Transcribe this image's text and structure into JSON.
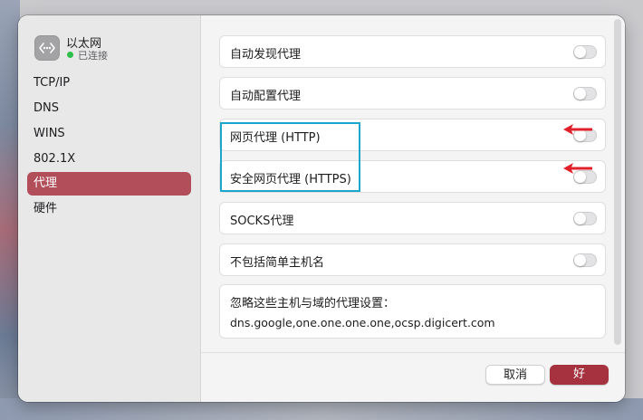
{
  "interface": {
    "name": "以太网",
    "status": "已连接",
    "icon": "ethernet-icon",
    "status_color": "#2fbe4a"
  },
  "sidebar": {
    "items": [
      {
        "label": "TCP/IP"
      },
      {
        "label": "DNS"
      },
      {
        "label": "WINS"
      },
      {
        "label": "802.1X"
      },
      {
        "label": "代理",
        "active": true
      },
      {
        "label": "硬件"
      }
    ],
    "active_color": "#b24e5a"
  },
  "proxies": [
    {
      "label": "自动发现代理",
      "enabled": false
    },
    {
      "label": "自动配置代理",
      "enabled": false
    },
    {
      "label": "网页代理 (HTTP)",
      "enabled": false
    },
    {
      "label": "安全网页代理 (HTTPS)",
      "enabled": false
    },
    {
      "label": "SOCKS代理",
      "enabled": false
    },
    {
      "label": "不包括简单主机名",
      "enabled": false
    }
  ],
  "bypass": {
    "label": "忽略这些主机与域的代理设置：",
    "value": "dns.google,one.one.one.one,ocsp.digicert.com"
  },
  "annotations": {
    "highlight_color": "#1ba7cd",
    "arrow_color": "#e0202a"
  },
  "buttons": {
    "cancel": "取消",
    "ok": "好",
    "ok_color": "#a6323f"
  }
}
